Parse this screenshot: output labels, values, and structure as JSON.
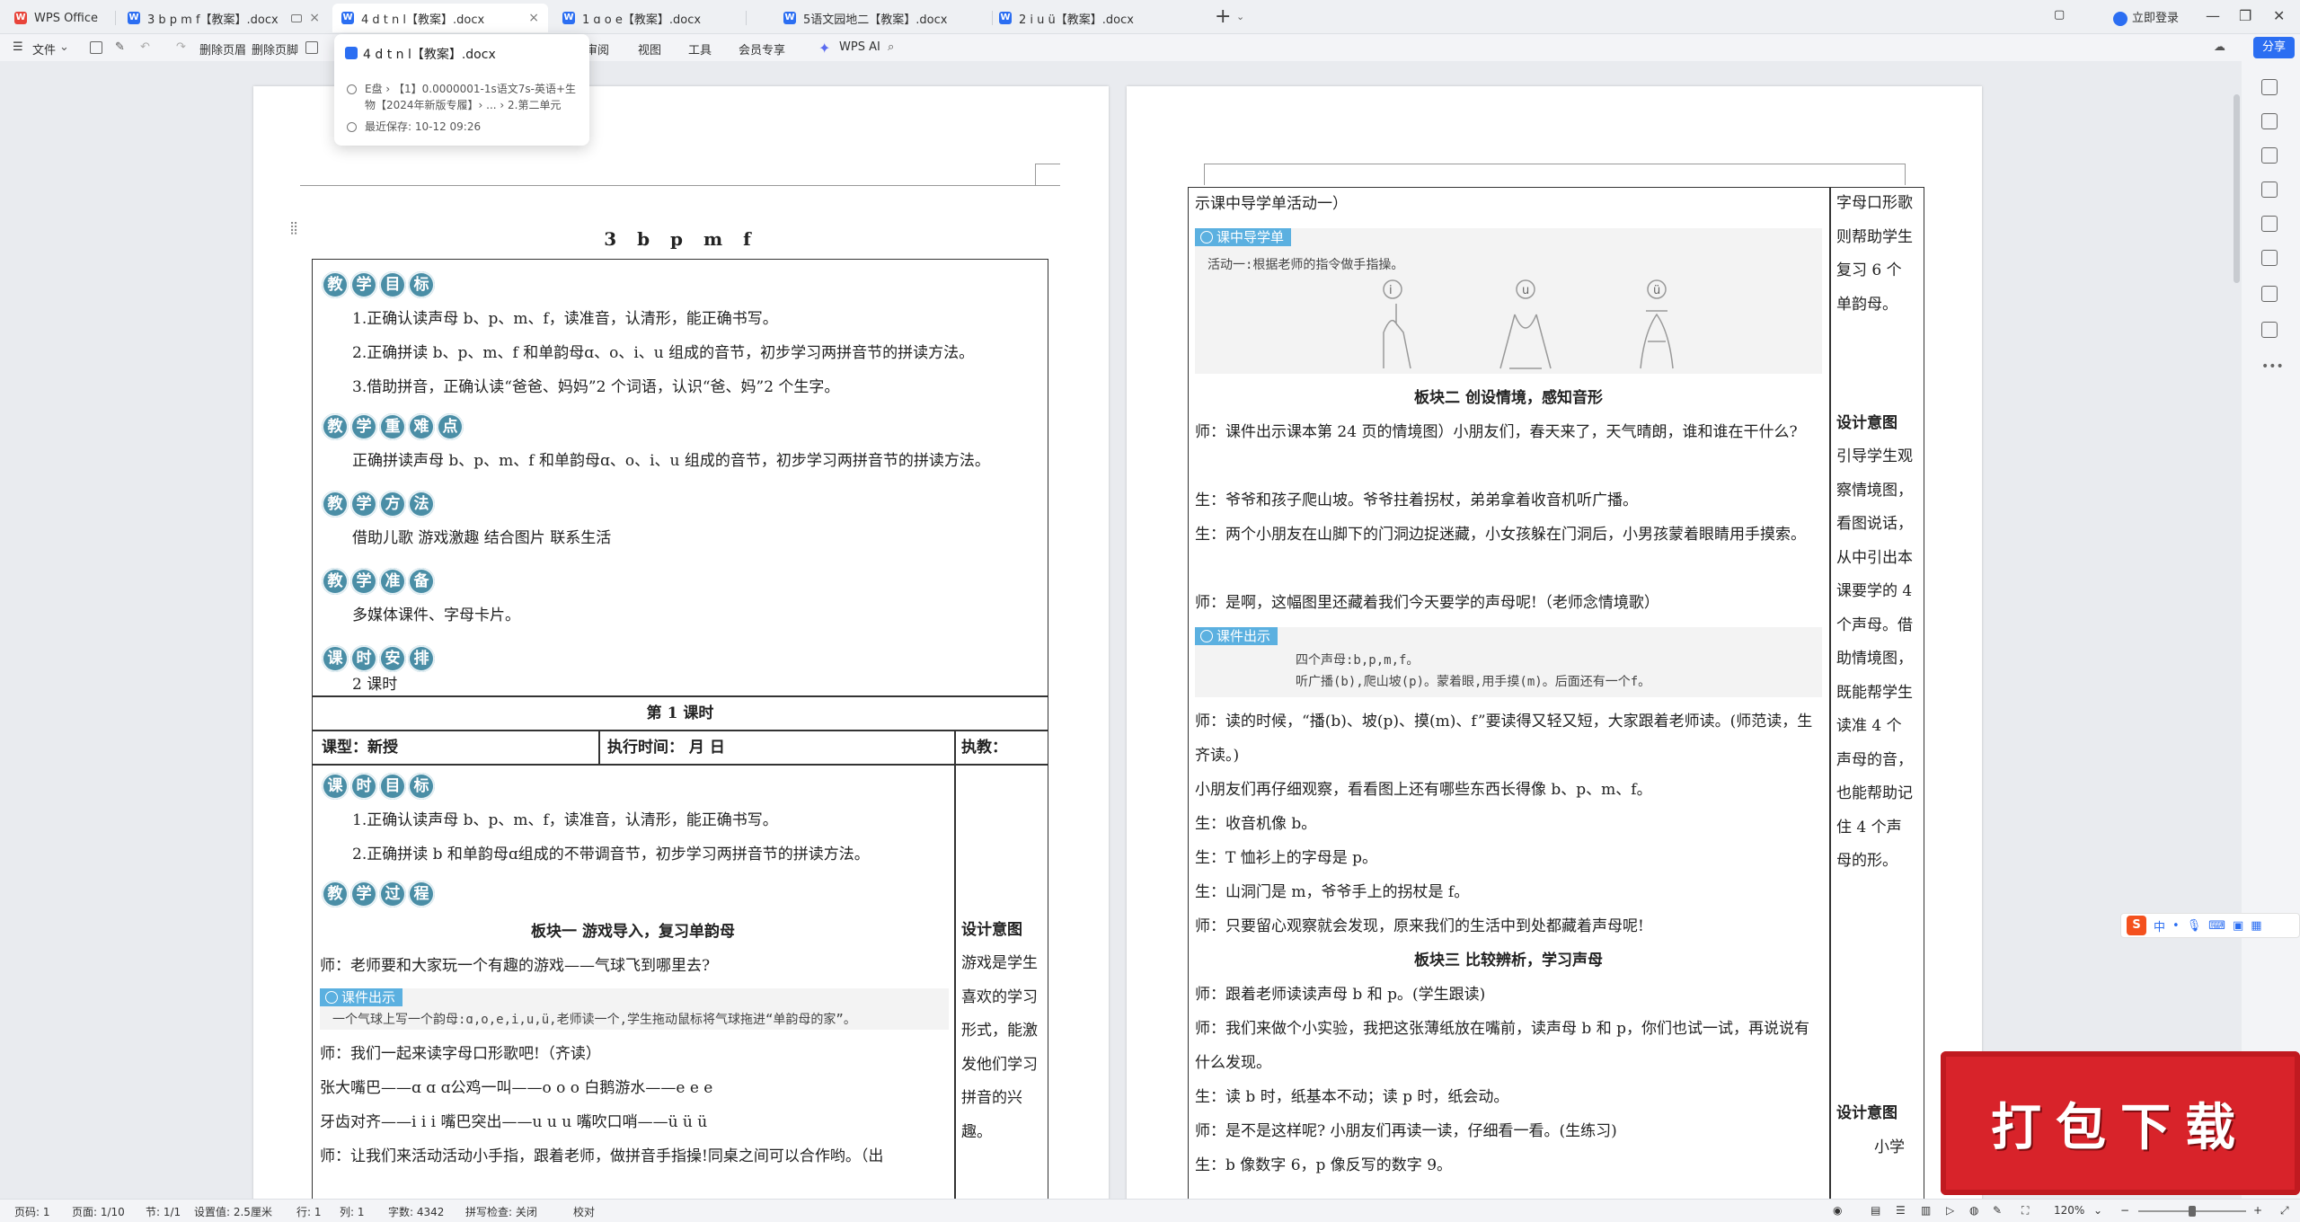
{
  "app": {
    "brand": "WPS Office",
    "tabs": [
      {
        "title": "3 b p m f【教案】.docx"
      },
      {
        "title": "4 d t n l【教案】.docx"
      },
      {
        "title": "1 ɑ o e【教案】.docx"
      },
      {
        "title": "5语文园地二【教案】.docx"
      },
      {
        "title": "2 i u ü【教案】.docx"
      }
    ],
    "login": "立即登录",
    "share": "分享"
  },
  "menu": {
    "file": "文件",
    "delete_header": "删除页眉",
    "delete_footer": "删除页脚",
    "review": "审阅",
    "view": "视图",
    "tools": "工具",
    "member": "会员专享",
    "ai": "WPS AI"
  },
  "popup": {
    "title": "4 d t n l【教案】.docx",
    "path_line1": "E盘 › 【1】0.0000001-1s语文7s-英语+生",
    "path_line2": "物【2024年新版专履】› ... › 2.第二单元",
    "saved": "最近保存: 10-12 09:26"
  },
  "left_page": {
    "title": "3 b p m f",
    "goal_badge": [
      "教",
      "学",
      "目",
      "标"
    ],
    "goals": [
      "1.正确认读声母 b、p、m、f，读准音，认清形，能正确书写。",
      "2.正确拼读 b、p、m、f 和单韵母ɑ、o、i、u 组成的音节，初步学习两拼音节的拼读方法。",
      "3.借助拼音，正确认读“爸爸、妈妈”2 个词语，认识“爸、妈”2 个生字。"
    ],
    "key_badge": [
      "教",
      "学",
      "重",
      "难",
      "点"
    ],
    "key_text": "正确拼读声母 b、p、m、f 和单韵母ɑ、o、i、u 组成的音节，初步学习两拼音节的拼读方法。",
    "method_badge": [
      "教",
      "学",
      "方",
      "法"
    ],
    "method_text": "借助儿歌    游戏激趣    结合图片    联系生活",
    "prep_badge": [
      "教",
      "学",
      "准",
      "备"
    ],
    "prep_text": "多媒体课件、字母卡片。",
    "hours_badge": [
      "课",
      "时",
      "安",
      "排"
    ],
    "hours_text": "2 课时",
    "lesson1": "第 1 课时",
    "lesson_type": "课型：新授",
    "exec_time": "执行时间：       月        日",
    "teacher": "执教：",
    "goal2_badge": [
      "课",
      "时",
      "目",
      "标"
    ],
    "goals2": [
      "1.正确认读声母 b、p、m、f，读准音，认清形，能正确书写。",
      "2.正确拼读 b 和单韵母ɑ组成的不带调音节，初步学习两拼音节的拼读方法。"
    ],
    "process_badge": [
      "教",
      "学",
      "过",
      "程"
    ],
    "module1": "板块一   游戏导入，复习单韵母",
    "line_a": "师：老师要和大家玩一个有趣的游戏——气球飞到哪里去?",
    "callout1_tag": "课件出示",
    "callout1_text": "一个气球上写一个韵母:ɑ,o,e,i,u,ü,老师读一个,学生拖动鼠标将气球拖进“单韵母的家”。",
    "line_b": "师：我们一起来读字母口形歌吧!（齐读）",
    "line_c": "张大嘴巴——ɑ ɑ ɑ公鸡一叫——o o o 白鹅游水——e e e",
    "line_d": "牙齿对齐——i i i 嘴巴突出——u u u 嘴吹口哨——ü ü ü",
    "line_e": "师：让我们来活动活动小手指，跟着老师，做拼音手指操!同桌之间可以合作哟。（出",
    "side_title": "设计意图",
    "side_text": "游戏是学生喜欢的学习形式，能激发他们学习拼音的兴趣。"
  },
  "right_page": {
    "top_line": "示课中导学单活动一）",
    "callout_guide_tag": "课中导学单",
    "callout_guide_text": "活动一:根据老师的指令做手指操。",
    "finger_labels": [
      "i",
      "u",
      "ü"
    ],
    "module2": "板块二   创设情境，感知音形",
    "p1": "师：课件出示课本第 24 页的情境图）小朋友们，春天来了，天气晴朗，谁和谁在干什么?",
    "p2": "生：爷爷和孩子爬山坡。爷爷拄着拐杖，弟弟拿着收音机听广播。",
    "p3": "生：两个小朋友在山脚下的门洞边捉迷藏，小女孩躲在门洞后，小男孩蒙着眼睛用手摸索。",
    "p4": "师：是啊，这幅图里还藏着我们今天要学的声母呢!（老师念情境歌）",
    "callout2_tag": "课件出示",
    "callout2_l1": "四个声母:b,p,m,f。",
    "callout2_l2": "听广播(b),爬山坡(p)。蒙着眼,用手摸(m)。后面还有一个f。",
    "p5": "师：读的时候，“播(b)、坡(p)、摸(m)、f”要读得又轻又短，大家跟着老师读。(师范读，生齐读。)",
    "p6": "小朋友们再仔细观察，看看图上还有哪些东西长得像 b、p、m、f。",
    "p7": "生：收音机像 b。",
    "p8": "生：T 恤衫上的字母是 p。",
    "p9": "生：山洞门是 m，爷爷手上的拐杖是 f。",
    "p10": "师：只要留心观察就会发现，原来我们的生活中到处都藏着声母呢!",
    "module3": "板块三   比较辨析，学习声母",
    "p11": "师：跟着老师读读声母 b 和 p。(学生跟读)",
    "p12": "师：我们来做个小实验，我把这张薄纸放在嘴前，读声母 b 和 p，你们也试一试，再说说有什么发现。",
    "p13": "生：读 b 时，纸基本不动；读 p 时，纸会动。",
    "p14": "师：是不是这样呢? 小朋友们再读一读，仔细看一看。(生练习)",
    "p15": "生：b 像数字 6，p 像反写的数字 9。",
    "side_top": "字母口形歌则帮助学生复习 6 个单韵母。",
    "side_title1": "设计意图",
    "side_text1": "引导学生观察情境图，看图说话，从中引出本课要学的 4 个声母。借助情境图，既能帮学生读准 4 个声母的音，也能帮助记住 4 个声母的形。",
    "side_title2": "设计意图",
    "side_text2": "小学"
  },
  "status": {
    "page_no": "页码: 1",
    "pages": "页面: 1/10",
    "section": "节: 1/1",
    "setting": "设置值: 2.5厘米",
    "row": "行: 1",
    "col": "列: 1",
    "words": "字数: 4342",
    "spell": "拼写检查: 关闭",
    "proof": "校对",
    "zoom": "120%"
  },
  "ime": {
    "lang": "中"
  },
  "ad": {
    "text": "打包下载"
  }
}
